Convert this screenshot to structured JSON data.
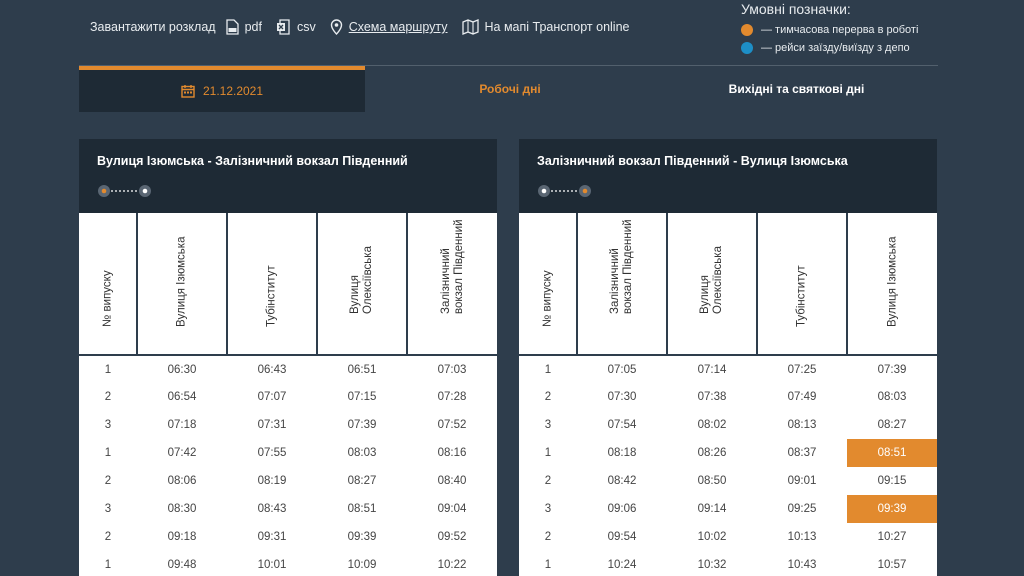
{
  "toolbar": {
    "download_label": "Завантажити розклад",
    "pdf_label": "pdf",
    "csv_label": "csv",
    "route_scheme_label": "Схема маршруту",
    "map_label": "На мапі Транспорт online"
  },
  "legend": {
    "title": "Умовні позначки:",
    "items": [
      {
        "label": "— тимчасова перерва в роботі",
        "color": "#e28a2e"
      },
      {
        "label": "— рейси заїзду/виїзду з депо",
        "color": "#1d8fc7"
      }
    ]
  },
  "tabs": {
    "date": "21.12.2021",
    "workdays": "Робочі дні",
    "weekends": "Вихідні та святкові дні"
  },
  "colors": {
    "accent": "#e28a2e",
    "depot": "#1d8fc7",
    "background": "#2e3d4c",
    "header": "#1e2a35"
  },
  "directions": [
    {
      "route": "Вулиця Ізюмська - Залізничний вокзал Південний",
      "columns": [
        "№ випуску",
        "Вулиця Ізюмська",
        "Тубінститут",
        "Вулиця\nОлексіївська",
        "Залізничний\nвокзал Південний"
      ],
      "rows": [
        [
          "1",
          "06:30",
          "06:43",
          "06:51",
          "07:03"
        ],
        [
          "2",
          "06:54",
          "07:07",
          "07:15",
          "07:28"
        ],
        [
          "3",
          "07:18",
          "07:31",
          "07:39",
          "07:52"
        ],
        [
          "1",
          "07:42",
          "07:55",
          "08:03",
          "08:16"
        ],
        [
          "2",
          "08:06",
          "08:19",
          "08:27",
          "08:40"
        ],
        [
          "3",
          "08:30",
          "08:43",
          "08:51",
          "09:04"
        ],
        [
          "2",
          "09:18",
          "09:31",
          "09:39",
          "09:52"
        ],
        [
          "1",
          "09:48",
          "10:01",
          "10:09",
          "10:22"
        ]
      ],
      "highlighted": []
    },
    {
      "route": "Залізничний вокзал Південний - Вулиця Ізюмська",
      "columns": [
        "№ випуску",
        "Залізничний\nвокзал Південний",
        "Вулиця\nОлексіївська",
        "Тубінститут",
        "Вулиця Ізюмська"
      ],
      "rows": [
        [
          "1",
          "07:05",
          "07:14",
          "07:25",
          "07:39"
        ],
        [
          "2",
          "07:30",
          "07:38",
          "07:49",
          "08:03"
        ],
        [
          "3",
          "07:54",
          "08:02",
          "08:13",
          "08:27"
        ],
        [
          "1",
          "08:18",
          "08:26",
          "08:37",
          "08:51"
        ],
        [
          "2",
          "08:42",
          "08:50",
          "09:01",
          "09:15"
        ],
        [
          "3",
          "09:06",
          "09:14",
          "09:25",
          "09:39"
        ],
        [
          "2",
          "09:54",
          "10:02",
          "10:13",
          "10:27"
        ],
        [
          "1",
          "10:24",
          "10:32",
          "10:43",
          "10:57"
        ]
      ],
      "highlighted": [
        [
          3,
          4
        ],
        [
          5,
          4
        ]
      ]
    }
  ]
}
